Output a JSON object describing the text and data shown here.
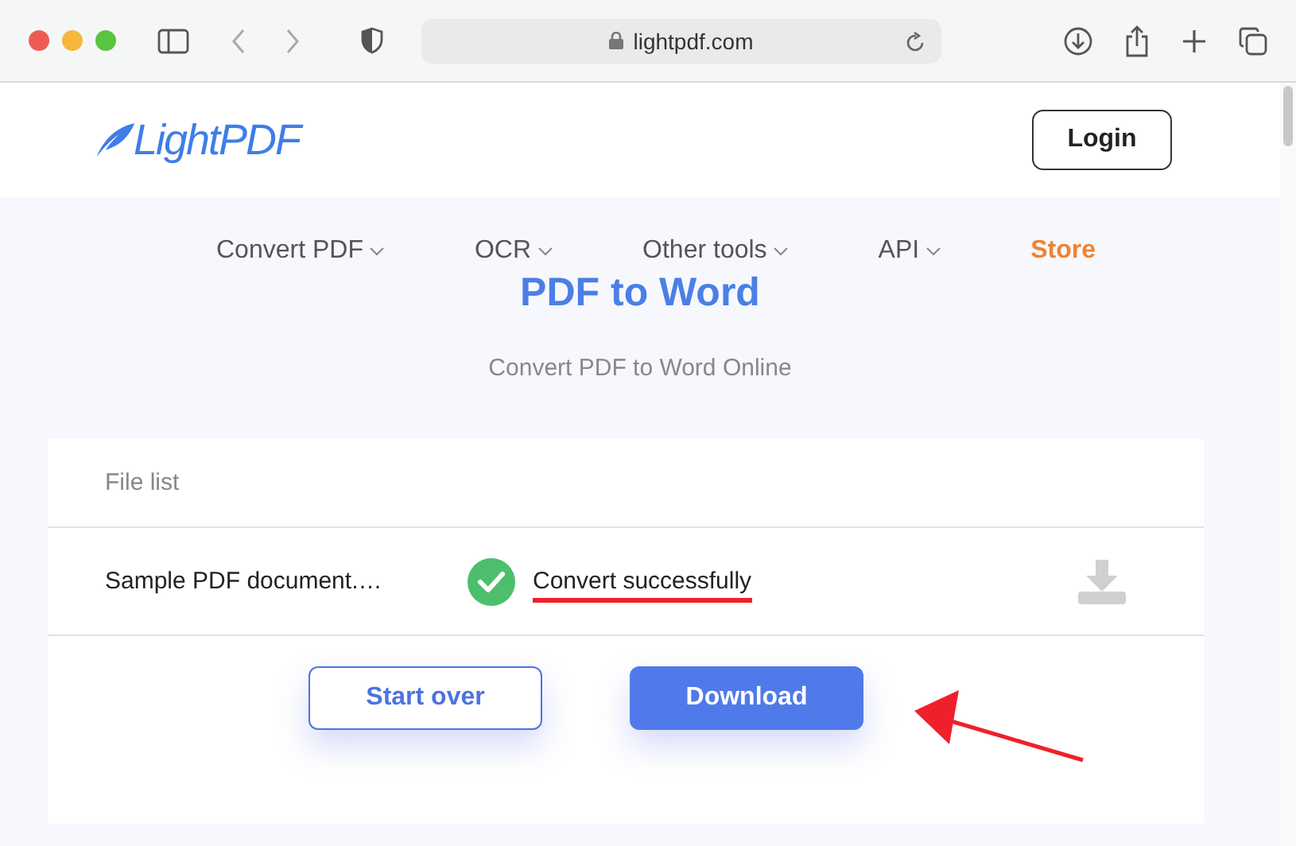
{
  "browser": {
    "address": "lightpdf.com"
  },
  "header": {
    "logo": "LightPDF",
    "login": "Login"
  },
  "nav": [
    {
      "label": "Convert PDF",
      "kind": "dropdown"
    },
    {
      "label": "OCR",
      "kind": "dropdown"
    },
    {
      "label": "Other tools",
      "kind": "dropdown"
    },
    {
      "label": "API",
      "kind": "dropdown"
    },
    {
      "label": "Store",
      "kind": "highlight"
    }
  ],
  "title": "PDF to Word",
  "subtitle": "Convert PDF to Word Online",
  "file_list": {
    "heading": "File list",
    "files": [
      {
        "name": "Sample PDF document.…",
        "status": "Convert successfully",
        "done": true
      }
    ]
  },
  "buttons": [
    {
      "label": "Start over",
      "kind": "secondary"
    },
    {
      "label": "Download",
      "kind": "primary"
    }
  ]
}
